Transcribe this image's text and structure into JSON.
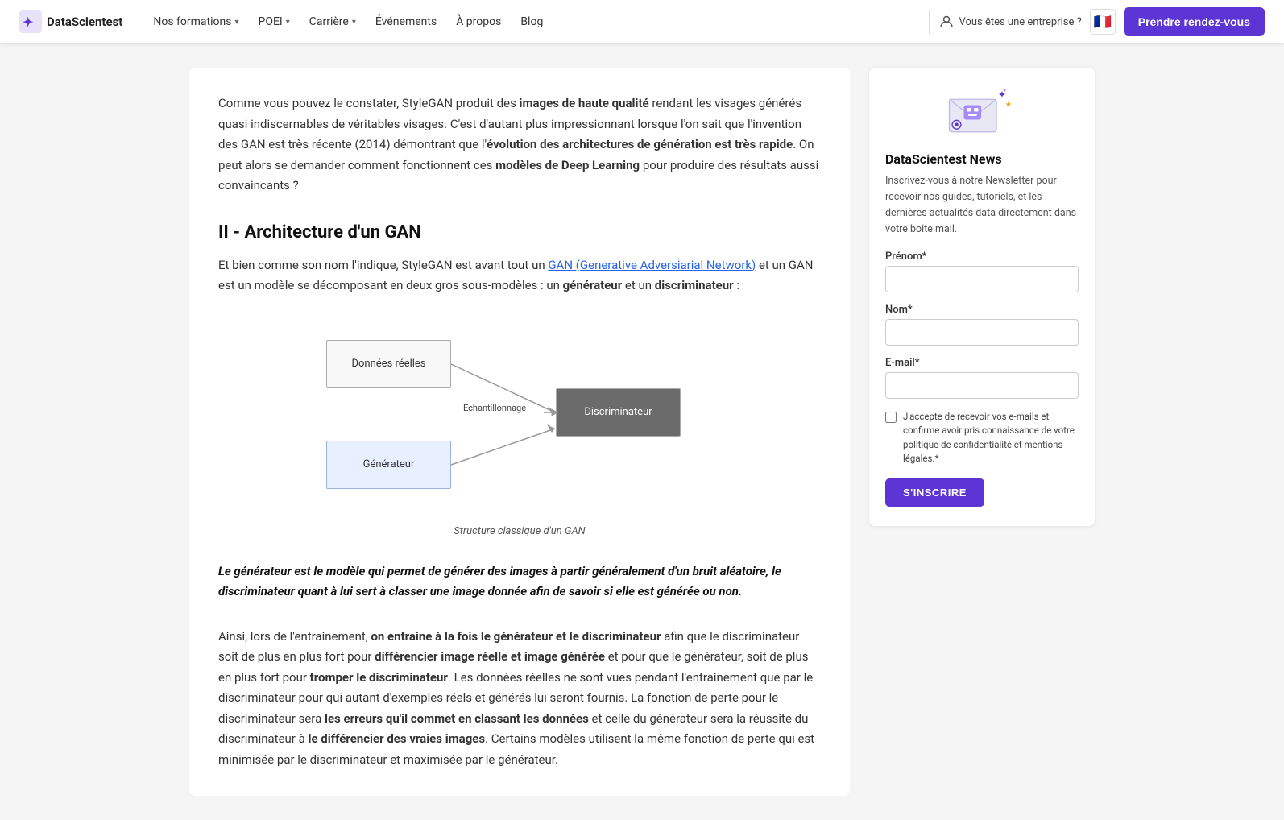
{
  "navbar": {
    "logo_text": "DataScientest",
    "nav_items": [
      {
        "label": "Nos formations",
        "has_dropdown": true
      },
      {
        "label": "POEI",
        "has_dropdown": true
      },
      {
        "label": "Carrière",
        "has_dropdown": true
      },
      {
        "label": "Événements",
        "has_dropdown": false
      },
      {
        "label": "À propos",
        "has_dropdown": false
      },
      {
        "label": "Blog",
        "has_dropdown": false
      }
    ],
    "enterprise_label": "Vous êtes une entreprise ?",
    "cta_label": "Prendre rendez-vous"
  },
  "main": {
    "intro_text_1": "Comme vous pouvez le constater, StyleGAN produit des ",
    "intro_bold_1": "images de haute qualité",
    "intro_text_2": " rendant les visages générés quasi indiscernables de véritables visages. C'est d'autant plus impressionnant lorsque l'on sait que l'invention des GAN est très récente (2014) démontrant que l'",
    "intro_bold_2": "évolution des architectures de génération est très rapide",
    "intro_text_3": ". On peut alors se demander comment fonctionnent ces ",
    "intro_bold_3": "modèles de Deep Learning",
    "intro_text_4": " pour produire des résultats aussi convaincants ?",
    "section_title": "II - Architecture d'un GAN",
    "body_text_1": "Et bien comme son nom l'indique, StyleGAN est avant tout un ",
    "body_link": "GAN (Generative Adversiarial Network)",
    "body_text_2": " et un GAN est un modèle se décomposant en deux gros sous-modèles : un ",
    "body_bold_1": "générateur",
    "body_text_3": " et un ",
    "body_bold_2": "discriminateur",
    "body_text_4": " :",
    "diagram_caption": "Structure classique d'un GAN",
    "diagram": {
      "box_donnees": "Données réelles",
      "box_generateur": "Générateur",
      "box_discriminateur": "Discriminateur",
      "echantillonnage": "Echantillonnage"
    },
    "blockquote": "Le générateur est le modèle qui permet de générer des images à partir généralement d'un bruit aléatoire, le discriminateur quant à lui sert à classer une image donnée afin de savoir si elle est générée ou non.",
    "bottom_text_1": "Ainsi, lors de l'entrainement, ",
    "bottom_bold_1": "on entraine à la fois le générateur et le discriminateur",
    "bottom_text_2": " afin que le discriminateur soit de plus en plus fort pour ",
    "bottom_bold_2": "différencier image réelle et image générée",
    "bottom_text_3": " et pour que le générateur, soit de plus en plus fort pour ",
    "bottom_bold_3": "tromper le discriminateur",
    "bottom_text_4": ". Les données réelles ne sont vues pendant l'entrainement que par le discriminateur pour qui autant d'exemples réels et générés lui seront fournis. La fonction de perte pour le discriminateur sera ",
    "bottom_bold_4": "les erreurs qu'il commet en classant les données",
    "bottom_text_5": " et celle du générateur sera la réussite du discriminateur à ",
    "bottom_bold_5": "le différencier des vraies images",
    "bottom_text_6": ". Certains modèles utilisent la même fonction de perte qui est minimisée par le discriminateur et maximisée par le générateur."
  },
  "sidebar": {
    "newsletter": {
      "title": "DataScientest News",
      "description": "Inscrivez-vous à notre Newsletter pour recevoir nos guides, tutoriels, et les dernières actualités data directement dans votre boite mail.",
      "prenom_label": "Prénom*",
      "nom_label": "Nom*",
      "email_label": "E-mail*",
      "checkbox_text": "J'accepte de recevoir vos e-mails et confirme avoir pris connaissance de votre politique de confidentialité et mentions légales.*",
      "subscribe_btn": "S'INSCRIRE"
    }
  }
}
